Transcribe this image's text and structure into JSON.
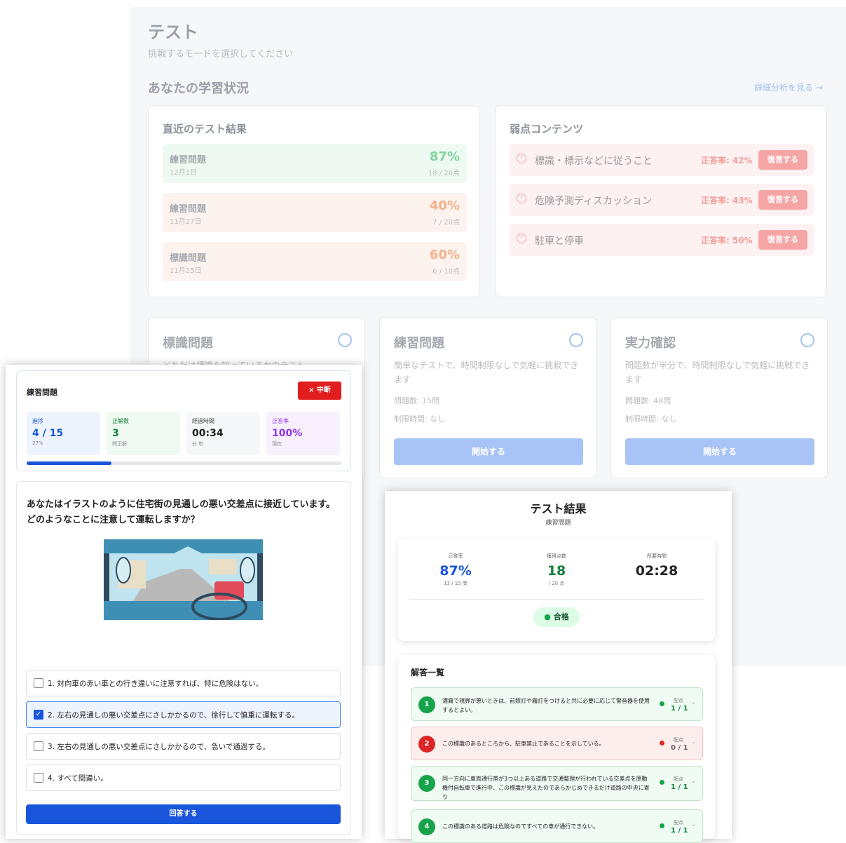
{
  "page": {
    "title": "テスト",
    "subtitle": "挑戦するモードを選択してください"
  },
  "status": {
    "heading": "あなたの学習状況",
    "detail_link": "詳細分析を見る →"
  },
  "recent": {
    "heading": "直近のテスト結果",
    "items": [
      {
        "title": "練習問題",
        "date": "12月1日",
        "percent": "87%",
        "score": "18 / 20点",
        "color": "#7fd3a0"
      },
      {
        "title": "練習問題",
        "date": "11月27日",
        "percent": "40%",
        "score": "7 / 20点",
        "color": "#f5b08c"
      },
      {
        "title": "標識問題",
        "date": "11月25日",
        "percent": "60%",
        "score": "6 / 10点",
        "color": "#f5b08c"
      }
    ]
  },
  "weak": {
    "heading": "弱点コンテンツ",
    "items": [
      {
        "title": "標識・標示などに従うこと",
        "rate": "正答率: 42%",
        "button": "復習する"
      },
      {
        "title": "危険予測ディスカッション",
        "rate": "正答率: 43%",
        "button": "復習する"
      },
      {
        "title": "駐車と停車",
        "rate": "正答率: 50%",
        "button": "復習する"
      }
    ]
  },
  "modes": [
    {
      "title": "標識問題",
      "desc": "どれだけ標識を知っているかのテスト",
      "count": "",
      "limit": "",
      "button": ""
    },
    {
      "title": "練習問題",
      "desc": "簡単なテストで、時間制限なしで気軽に挑戦できます",
      "count": "問題数: 15問",
      "limit": "制限時間: なし",
      "button": "開始する"
    },
    {
      "title": "実力確認",
      "desc": "問題数が半分で、時間制限なしで気軽に挑戦できます",
      "count": "問題数: 48問",
      "limit": "制限時間: なし",
      "button": "開始する"
    }
  ],
  "quiz": {
    "title": "練習問題",
    "abort": "× 中断",
    "stats": [
      {
        "label": "進捗",
        "value": "4 / 15",
        "sub": "27%",
        "bg": "#eef4fe",
        "color": "#1a56db"
      },
      {
        "label": "正解数",
        "value": "3",
        "sub": "問正解",
        "bg": "#effaf2",
        "color": "#15803d"
      },
      {
        "label": "経過時間",
        "value": "00:34",
        "sub": "分:秒",
        "bg": "#f6f7f8",
        "color": "#222"
      },
      {
        "label": "正答率",
        "value": "100%",
        "sub": "現在",
        "bg": "#f8f1fd",
        "color": "#9333ea"
      }
    ],
    "progress": 0.27,
    "question": "あなたはイラストのように住宅街の見通しの悪い交差点に接近しています。どのようなことに注意して運転しますか？",
    "choices": [
      {
        "text": "1. 対向車の赤い車との行き違いに注意すれば、特に危険はない。",
        "checked": false
      },
      {
        "text": "2. 左右の見通しの悪い交差点にさしかかるので、徐行して慎重に運転する。",
        "checked": true
      },
      {
        "text": "3. 左右の見通しの悪い交差点にさしかかるので、急いで通過する。",
        "checked": false
      },
      {
        "text": "4. すべて間違い。",
        "checked": false
      }
    ],
    "submit": "回答する"
  },
  "result": {
    "title": "テスト結果",
    "subtitle": "練習問題",
    "stats": [
      {
        "label": "正答率",
        "value": "87%",
        "sub": "13 / 15 問",
        "color": "#1a56db"
      },
      {
        "label": "獲得点数",
        "value": "18",
        "sub": "/ 20 点",
        "color": "#15803d"
      },
      {
        "label": "所要時間",
        "value": "02:28",
        "sub": "",
        "color": "#222"
      }
    ],
    "pass": "合格",
    "list_heading": "解答一覧",
    "score_label": "配点",
    "answers": [
      {
        "num": "1",
        "text": "濃霧で視界が悪いときは、前照灯や霧灯をつけると共に必要に応じて警音器を使用するとよい。",
        "score": "1 / 1",
        "ok": true
      },
      {
        "num": "2",
        "text": "この標識のあるところから、駐車禁止であることを示している。",
        "score": "0 / 1",
        "ok": false
      },
      {
        "num": "3",
        "text": "同一方向に車両通行帯が3つ以上ある道路で交通整理が行われている交差点を原動機付自転車で進行中、この標識が見えたのであらかじめできるだけ道路の中央に寄り",
        "score": "1 / 1",
        "ok": true
      },
      {
        "num": "4",
        "text": "この標識のある道路は危険なのですべての車が通行できない。",
        "score": "1 / 1",
        "ok": true
      }
    ]
  }
}
